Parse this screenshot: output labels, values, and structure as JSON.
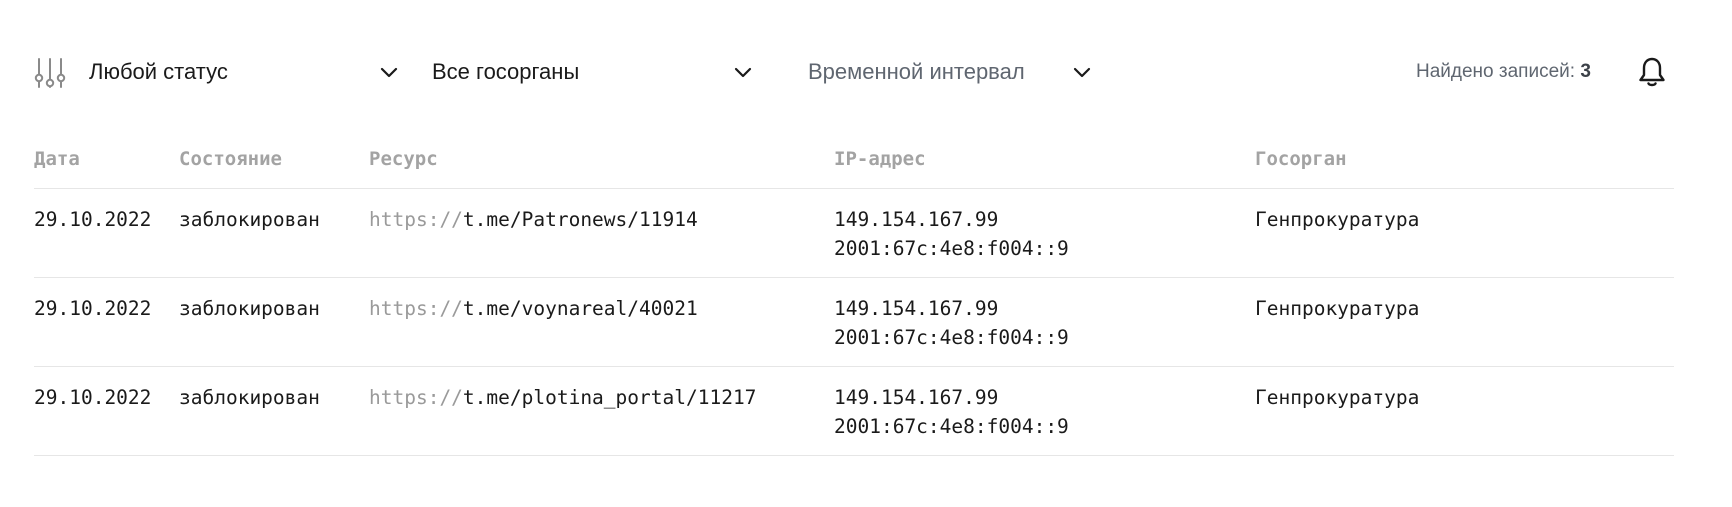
{
  "filters": {
    "status": {
      "label": "Любой статус"
    },
    "org": {
      "label": "Все госорганы"
    },
    "time": {
      "label": "Временной интервал"
    },
    "found_label": "Найдено записей:",
    "found_count": "3"
  },
  "table": {
    "headers": {
      "date": "Дата",
      "state": "Состояние",
      "resource": "Ресурс",
      "ip": "IP-адрес",
      "org": "Госорган"
    },
    "rows": [
      {
        "date": "29.10.2022",
        "state": "заблокирован",
        "protocol": "https://",
        "resource": "t.me/Patronews/11914",
        "ipv4": "149.154.167.99",
        "ipv6": "2001:67c:4e8:f004::9",
        "org": "Генпрокуратура"
      },
      {
        "date": "29.10.2022",
        "state": "заблокирован",
        "protocol": "https://",
        "resource": "t.me/voynareal/40021",
        "ipv4": "149.154.167.99",
        "ipv6": "2001:67c:4e8:f004::9",
        "org": "Генпрокуратура"
      },
      {
        "date": "29.10.2022",
        "state": "заблокирован",
        "protocol": "https://",
        "resource": "t.me/plotina_portal/11217",
        "ipv4": "149.154.167.99",
        "ipv6": "2001:67c:4e8:f004::9",
        "org": "Генпрокуратура"
      }
    ]
  },
  "icons": {
    "filter": "sliders-icon",
    "chevron": "chevron-down-icon",
    "bell": "bell-icon"
  }
}
